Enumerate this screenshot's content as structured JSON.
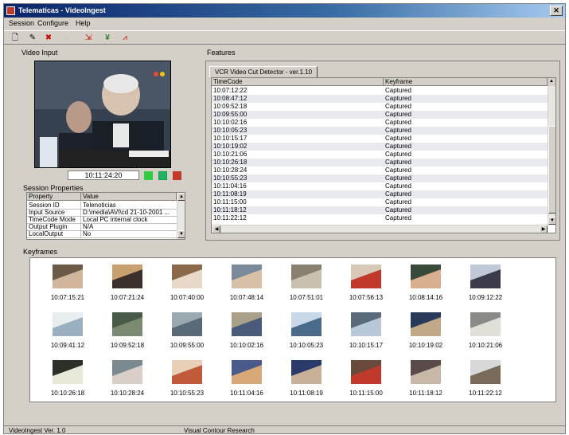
{
  "window": {
    "title": "Telematicas - VideoIngest"
  },
  "menu": [
    "Session",
    "Configure",
    "Help"
  ],
  "toolbar_icons": [
    "new-icon",
    "open-icon",
    "delete-icon",
    "stop-icon",
    "export-icon",
    "tree-icon",
    "chart-icon"
  ],
  "video_input": {
    "label": "Video Input",
    "timecode": "10:11:24:20"
  },
  "session_properties": {
    "label": "Session Properties",
    "columns": [
      "Property",
      "Value"
    ],
    "rows": [
      [
        "Session ID",
        "Telenoticias"
      ],
      [
        "Input Source",
        "D:\\media\\AVI\\cd 21-10-2001 ..."
      ],
      [
        "TimeCode Mode",
        "Local PC internal clock"
      ],
      [
        "Output Plugin",
        "N/A"
      ],
      [
        "LocalOutput",
        "No"
      ]
    ]
  },
  "features": {
    "label": "Features",
    "tab": "VCR Video Cut Detector - ver.1.10",
    "columns": [
      "TimeCode",
      "Keyframe"
    ],
    "rows": [
      [
        "10:07:12:22",
        "Captured"
      ],
      [
        "10:08:47:12",
        "Captured"
      ],
      [
        "10:09:52:18",
        "Captured"
      ],
      [
        "10:09:55:00",
        "Captured"
      ],
      [
        "10:10:02:16",
        "Captured"
      ],
      [
        "10:10:05:23",
        "Captured"
      ],
      [
        "10:10:15:17",
        "Captured"
      ],
      [
        "10:10:19:02",
        "Captured"
      ],
      [
        "10:10:21:06",
        "Captured"
      ],
      [
        "10:10:26:18",
        "Captured"
      ],
      [
        "10:10:28:24",
        "Captured"
      ],
      [
        "10:10:55:23",
        "Captured"
      ],
      [
        "10:11:04:16",
        "Captured"
      ],
      [
        "10:11:08:19",
        "Captured"
      ],
      [
        "10:11:15:00",
        "Captured"
      ],
      [
        "10:11:18:12",
        "Captured"
      ],
      [
        "10:11:22:12",
        "Captured"
      ]
    ]
  },
  "keyframes": {
    "label": "Keyframes",
    "items": [
      "10:07:15:21",
      "10:07:21:24",
      "10:07:40:00",
      "10:07:48:14",
      "10:07:51:01",
      "10:07:56:13",
      "10:08:14:16",
      "10:09:12:22",
      "10:09:41:12",
      "10:09:52:18",
      "10:09:55:00",
      "10:10:02:16",
      "10:10:05:23",
      "10:10:15:17",
      "10:10:19:02",
      "10:10:21:06",
      "10:10:26:18",
      "10:10:28:24",
      "10:10:55:23",
      "10:11:04:16",
      "10:11:08:19",
      "10:11:15:00",
      "10:11:18:12",
      "10:11:22:12"
    ]
  },
  "status": {
    "version": "VideoIngest Ver. 1.0",
    "company": "Visual Contour Research"
  }
}
